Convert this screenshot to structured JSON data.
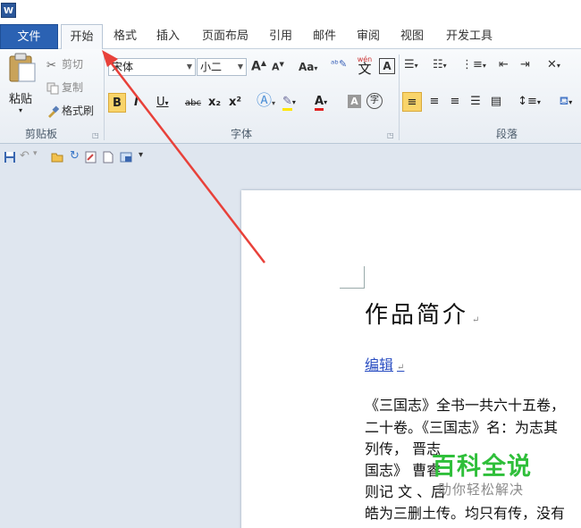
{
  "app": {
    "icon_letter": "W"
  },
  "tabs": [
    "文件",
    "开始",
    "格式",
    "插入",
    "页面布局",
    "引用",
    "邮件",
    "审阅",
    "视图",
    "开发工具"
  ],
  "clipboard": {
    "paste": "粘贴",
    "cut": "剪切",
    "copy": "复制",
    "format_painter": "格式刷",
    "group_label": "剪贴板"
  },
  "font": {
    "family": "宋体",
    "size": "小二",
    "group_label": "字体",
    "aa_label": "Aa",
    "bold": "B",
    "italic": "I",
    "underline": "U",
    "strike": "abc",
    "sub": "x₂",
    "sup": "x²",
    "font_color": "A",
    "shade": "A",
    "circle": "字",
    "grow": "A",
    "shrink": "A",
    "phonetic_top": "wén",
    "phonetic_char": "文",
    "border_char": "A"
  },
  "paragraph": {
    "group_label": "段落"
  },
  "document": {
    "title": "作品简介",
    "edit_link": "编辑",
    "lines": [
      "《三国志》全书一共六十五卷，",
      "二十卷。《三国志》名：为志其",
      "列传，           晋志",
      "国志》              曹睿",
      "则记  文              、后",
      "皓为三删土传。均只有传，没有"
    ]
  },
  "watermark": {
    "title": "百科全说",
    "subtitle": "助你轻松解决"
  },
  "colors": {
    "file_tab": "#2b62b3",
    "accent_yellow": "#f9d46a",
    "arrow": "#e8413a",
    "watermark_green": "#2fbf3a"
  }
}
